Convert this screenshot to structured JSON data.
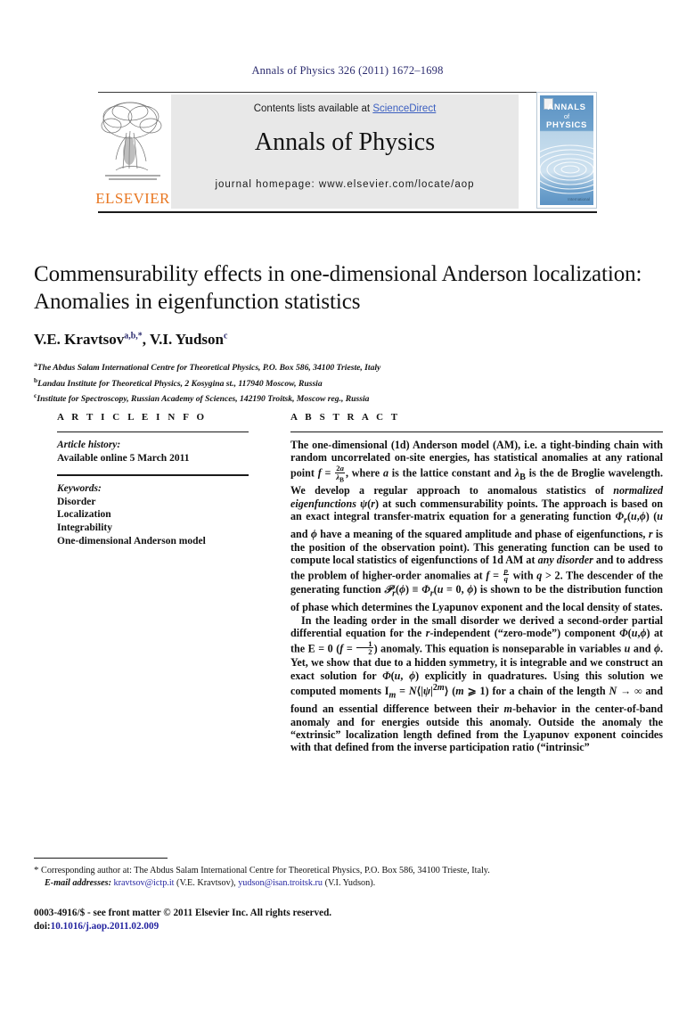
{
  "running_head": "Annals of Physics 326 (2011) 1672–1698",
  "masthead": {
    "contents_prefix": "Contents lists available at ",
    "sciencedirect_link": "ScienceDirect",
    "journal_title": "Annals of Physics",
    "homepage_line": "journal homepage: www.elsevier.com/locate/aop",
    "publisher_name": "ELSEVIER",
    "cover": {
      "line1": "ANNALS",
      "line2": "of",
      "line3": "PHYSICS",
      "footer_mark": "International"
    }
  },
  "article": {
    "title": "Commensurability effects in one-dimensional Anderson localization: Anomalies in eigenfunction statistics",
    "authors_html": "V.E. Kravtsov<sup>a,b,*</sup>, V.I. Yudson<sup>c</sup>",
    "affiliations": [
      {
        "mark": "a",
        "text": "The Abdus Salam International Centre for Theoretical Physics, P.O. Box 586, 34100 Trieste, Italy"
      },
      {
        "mark": "b",
        "text": "Landau Institute for Theoretical Physics, 2 Kosygina st., 117940 Moscow, Russia"
      },
      {
        "mark": "c",
        "text": "Institute for Spectroscopy, Russian Academy of Sciences, 142190 Troitsk, Moscow reg., Russia"
      }
    ]
  },
  "info_heading": "A R T I C L E    I N F O",
  "abstract_heading": "A B S T R A C T",
  "article_history": {
    "label": "Article history:",
    "lines": [
      "Available online 5 March 2011"
    ]
  },
  "keywords": {
    "label": "Keywords:",
    "items": [
      "Disorder",
      "Localization",
      "Integrability",
      "One-dimensional Anderson model"
    ]
  },
  "abstract": {
    "para1_html": "The one-dimensional (1d) Anderson model (AM), i.e. a tight-binding chain with random uncorrelated on-site energies, has statistical anomalies at any rational point <span class=\"mvar\">f</span> = <span class=\"frac\"><span class=\"num\">2<span class=\"mvar\">a</span></span><span class=\"den\"><span class=\"mvar\">λ</span><sub>B</sub></span></span>, where <span class=\"mvar\">a</span> is the lattice constant and <span class=\"mvar\">λ</span><sub>B</sub> is the de Broglie wavelength. We develop a regular approach to anomalous statistics of <i>normalized eigenfunctions</i> <span class=\"mvar\">ψ</span>(<span class=\"mvar\">r</span>) at such commensurability points. The approach is based on an exact integral transfer-matrix equation for a generating function <span class=\"mvar\">Φ</span><sub><span class=\"mvar\">r</span></sub>(<span class=\"mvar\">u</span>,<span class=\"mvar\">ϕ</span>) (<span class=\"mvar\">u</span> and <span class=\"mvar\">ϕ</span> have a meaning of the squared amplitude and phase of eigenfunctions, <span class=\"mvar\">r</span> is the position of the observation point). This generating function can be used to compute local statistics of eigenfunctions of 1d AM at <i>any disorder</i> and to address the problem of higher-order anomalies at <span class=\"mvar\">f</span> = <span class=\"frac\"><span class=\"num\"><span class=\"mvar\">p</span></span><span class=\"den\"><span class=\"mvar\">q</span></span></span> with <span class=\"mvar\">q</span> &gt; 2. The descender of the generating function <span class=\"mvar\">𝒫</span><sub><span class=\"mvar\">r</span></sub>(<span class=\"mvar\">ϕ</span>) ≡ <span class=\"mvar\">Φ</span><sub><span class=\"mvar\">r</span></sub>(<span class=\"mvar\">u</span> = 0, <span class=\"mvar\">ϕ</span>) is shown to be the distribution function of phase which determines the Lyapunov exponent and the local density of states.",
    "para2_html": "In the leading order in the small disorder we derived a second-order partial differential equation for the <span class=\"mvar\">r</span>-independent (“zero-mode”) component <span class=\"mvar\">Φ</span>(<span class=\"mvar\">u</span>,<span class=\"mvar\">ϕ</span>) at the E = 0 (<span class=\"mvar\">f</span> = <span class=\"frac\"><span class=\"num\">1</span><span class=\"den\">2</span></span>) anomaly. This equation is nonseparable in variables <span class=\"mvar\">u</span> and <span class=\"mvar\">ϕ</span>. Yet, we show that due to a hidden symmetry, it is integrable and we construct an exact solution for <span class=\"mvar\">Φ</span>(<span class=\"mvar\">u</span>, <span class=\"mvar\">ϕ</span>) explicitly in quadratures. Using this solution we computed moments I<sub><span class=\"mvar\">m</span></sub> = <span class=\"mvar\">N</span>⟨|<span class=\"mvar\">ψ</span>|<sup>2<span class=\"mvar\">m</span></sup>⟩ (<span class=\"mvar\">m</span> ⩾ 1) for a chain of the length <span class=\"mvar\">N</span> → ∞ and found an essential difference between their <span class=\"mvar\">m</span>-behavior in the center-of-band anomaly and for energies outside this anomaly. Outside the anomaly the “extrinsic” localization length defined from the Lyapunov exponent coincides with that defined from the inverse participation ratio (“intrinsic”"
  },
  "footnote": {
    "star": "*",
    "line1": "Corresponding author at: The Abdus Salam International Centre for Theoretical Physics, P.O. Box 586, 34100 Trieste, Italy.",
    "emails_label": "E-mail addresses:",
    "email1": "kravtsov@ictp.it",
    "email1_owner": "(V.E. Kravtsov),",
    "email2": "yudson@isan.troitsk.ru",
    "email2_owner": "(V.I. Yudson)."
  },
  "copyright": {
    "line1": "0003-4916/$ - see front matter © 2011 Elsevier Inc. All rights reserved.",
    "doi_prefix": "doi:",
    "doi_value": "10.1016/j.aop.2011.02.009"
  },
  "colors": {
    "link_blue": "#3b5fc0",
    "running_head_blue": "#2b2b6e",
    "elsevier_orange": "#e87722",
    "cover_blue": "#5c93c4",
    "masthead_gray": "#e8e8e8"
  }
}
